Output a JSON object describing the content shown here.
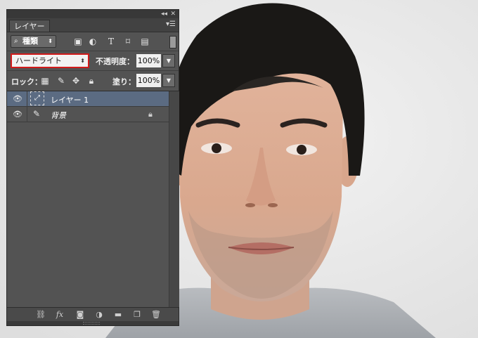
{
  "panel": {
    "tab_label": "レイヤー",
    "collapse_glyph": "◂◂",
    "close_glyph": "✕",
    "menu_glyph": "▾☰",
    "filter": {
      "kind_label": "種類",
      "icons": [
        "image-filter-icon",
        "adjustment-filter-icon",
        "type-filter-icon",
        "shape-filter-icon",
        "smart-object-filter-icon"
      ]
    },
    "blend_mode": "ハードライト",
    "opacity_label": "不透明度：",
    "opacity_value": "100%",
    "lock_label": "ロック：",
    "fill_label": "塗り：",
    "fill_value": "100%",
    "layers": [
      {
        "name": "レイヤー 1",
        "selected": true,
        "visible": true,
        "locked": false
      },
      {
        "name": "背景",
        "selected": false,
        "visible": true,
        "locked": true
      }
    ],
    "bottom_icons": [
      "link-icon",
      "fx-icon",
      "mask-icon",
      "adjustment-icon",
      "folder-icon",
      "new-layer-icon",
      "trash-icon"
    ]
  },
  "colors": {
    "panel_bg": "#535353",
    "selection": "#5b6b82",
    "highlight_border": "#d11b1b"
  }
}
